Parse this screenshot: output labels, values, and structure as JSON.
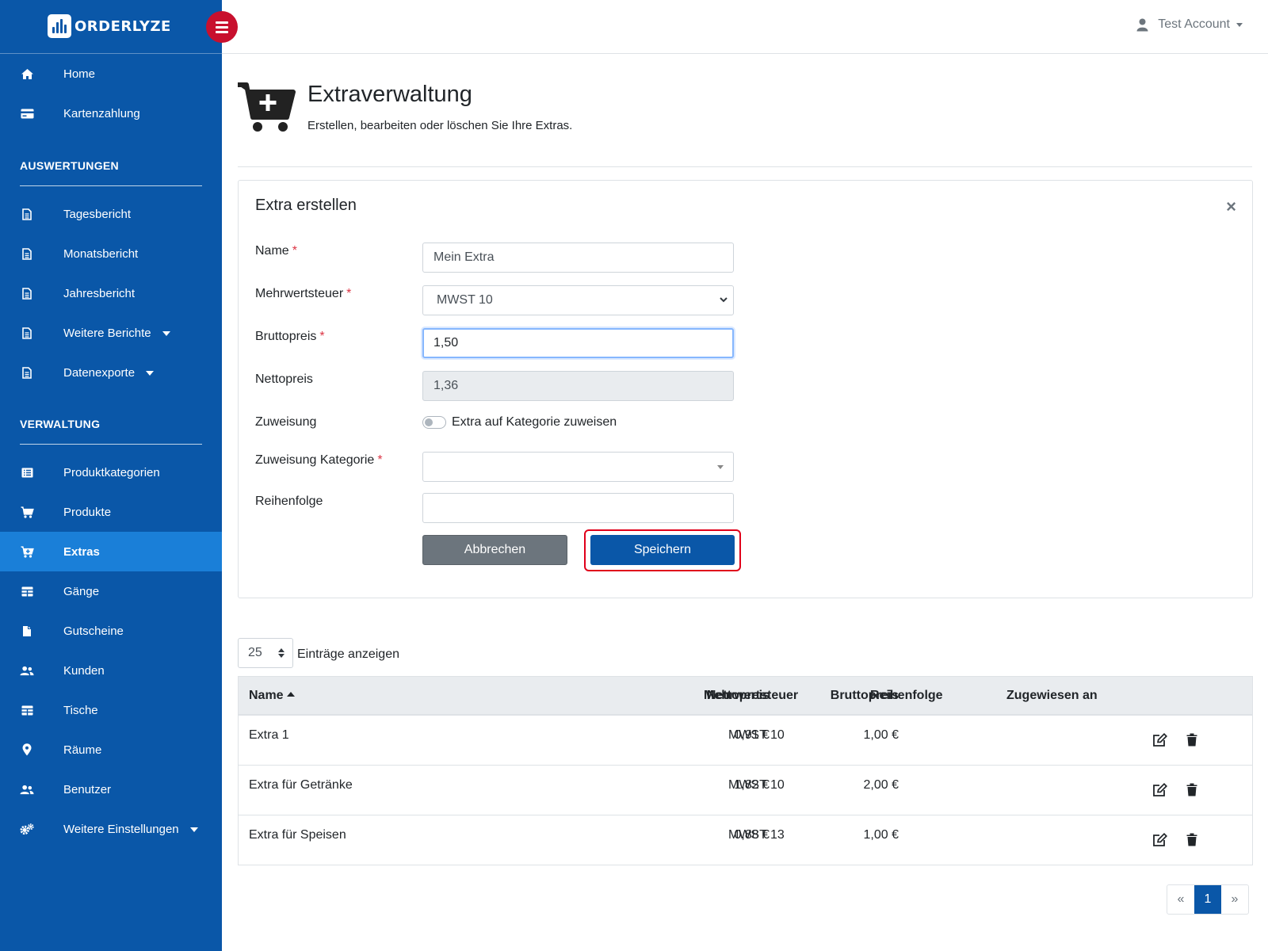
{
  "brand": {
    "name": "ORDERLYZE"
  },
  "topbar": {
    "account_label": "Test Account"
  },
  "sidebar": {
    "top_items": [
      {
        "label": "Home",
        "icon": "home-icon"
      },
      {
        "label": "Kartenzahlung",
        "icon": "credit-card-icon"
      }
    ],
    "sections": [
      {
        "heading": "AUSWERTUNGEN",
        "items": [
          {
            "label": "Tagesbericht",
            "icon": "file-icon"
          },
          {
            "label": "Monatsbericht",
            "icon": "file-icon"
          },
          {
            "label": "Jahresbericht",
            "icon": "file-icon"
          },
          {
            "label": "Weitere Berichte",
            "icon": "file-icon"
          },
          {
            "label": "Datenexporte",
            "icon": "file-icon"
          }
        ]
      },
      {
        "heading": "VERWALTUNG",
        "items": [
          {
            "label": "Produktkategorien",
            "icon": "list-icon"
          },
          {
            "label": "Produkte",
            "icon": "cart-icon"
          },
          {
            "label": "Extras",
            "icon": "cart-plus-icon",
            "active": true
          },
          {
            "label": "Gänge",
            "icon": "table-icon"
          },
          {
            "label": "Gutscheine",
            "icon": "document-icon"
          },
          {
            "label": "Kunden",
            "icon": "users-icon"
          },
          {
            "label": "Tische",
            "icon": "table-icon"
          },
          {
            "label": "Räume",
            "icon": "map-pin-icon"
          },
          {
            "label": "Benutzer",
            "icon": "users-icon"
          },
          {
            "label": "Weitere Einstellungen",
            "icon": "gears-icon"
          }
        ]
      }
    ]
  },
  "page": {
    "title": "Extraverwaltung",
    "subtitle": "Erstellen, bearbeiten oder löschen Sie Ihre Extras."
  },
  "form": {
    "title": "Extra erstellen",
    "close_symbol": "×",
    "name_label": "Name",
    "name_value": "Mein Extra",
    "vat_label": "Mehrwertsteuer",
    "vat_value": "MWST 10",
    "gross_label": "Bruttopreis",
    "gross_value": "1,50",
    "net_label": "Nettopreis",
    "net_value": "1,36",
    "assign_label": "Zuweisung",
    "assign_toggle_label": "Extra auf Kategorie zuweisen",
    "assign_category_label": "Zuweisung Kategorie",
    "assign_category_value": "",
    "order_label": "Reihenfolge",
    "order_value": "",
    "required_mark": "*",
    "cancel_label": "Abbrechen",
    "save_label": "Speichern"
  },
  "table": {
    "page_length": "25",
    "page_length_label": "Einträge anzeigen",
    "headers": [
      "Name",
      "Nettopreis",
      "Bruttopreis",
      "Mehrwertsteuer",
      "Reihenfolge",
      "Zugewiesen an"
    ],
    "rows": [
      {
        "name": "Extra 1",
        "net": "0,91 €",
        "gross": "1,00 €",
        "vat": "MWST 10",
        "order": "",
        "assigned": ""
      },
      {
        "name": "Extra für Getränke",
        "net": "1,82 €",
        "gross": "2,00 €",
        "vat": "MWST 10",
        "order": "",
        "assigned": ""
      },
      {
        "name": "Extra für Speisen",
        "net": "0,88 €",
        "gross": "1,00 €",
        "vat": "MWST 13",
        "order": "",
        "assigned": ""
      }
    ]
  },
  "pagination": {
    "prev": "«",
    "current": "1",
    "next": "»"
  }
}
